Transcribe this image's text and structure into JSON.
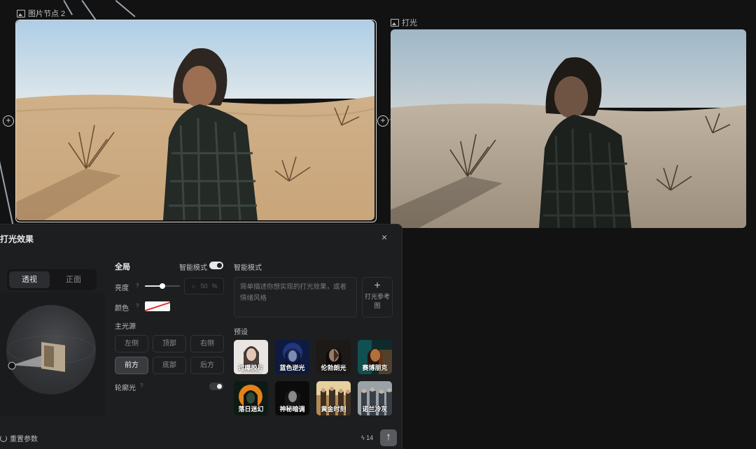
{
  "canvas": {
    "node1": {
      "label": "图片节点 2",
      "icon": "image-icon"
    },
    "node2": {
      "label": "打光",
      "icon": "image-icon"
    },
    "port_symbol": "+"
  },
  "panel": {
    "title": "打光效果",
    "close_symbol": "×",
    "view_tabs": [
      {
        "label": "透视",
        "active": true
      },
      {
        "label": "正面",
        "active": false
      }
    ],
    "section_global": "全局",
    "smart_mode_label": "智能模式",
    "smart_mode_on": true,
    "brightness": {
      "label": "亮度",
      "hint": "?",
      "value": 50,
      "value_text": "50",
      "unit": "%",
      "sun_symbol": "☼"
    },
    "color": {
      "label": "颜色",
      "hint": "?",
      "value": "#ffffff"
    },
    "main_light_label": "主光源",
    "light_positions": [
      {
        "label": "左侧",
        "active": false
      },
      {
        "label": "顶部",
        "active": false
      },
      {
        "label": "右侧",
        "active": false
      },
      {
        "label": "前方",
        "active": true
      },
      {
        "label": "底部",
        "active": false
      },
      {
        "label": "后方",
        "active": false
      }
    ],
    "rim_light": {
      "label": "轮廓光",
      "hint": "?",
      "on": false
    },
    "smart_section_label": "智能模式",
    "description_placeholder": "简单描述你想实现的打光效果，或者情绪风格",
    "ref_button": {
      "plus": "+",
      "label": "打光参考图"
    },
    "presets_label": "预设",
    "presets": [
      {
        "label": "过曝胶片"
      },
      {
        "label": "蓝色逆光"
      },
      {
        "label": "伦勃朗光"
      },
      {
        "label": "赛博朋克"
      },
      {
        "label": "落日迷幻"
      },
      {
        "label": "神秘暗调"
      },
      {
        "label": "黄金时刻"
      },
      {
        "label": "诺兰冷灰"
      }
    ],
    "reset_label": "重置参数",
    "cost": {
      "icon": "lightning-icon",
      "symbol": "ϟ",
      "value": "14"
    },
    "send_symbol": "↑"
  }
}
